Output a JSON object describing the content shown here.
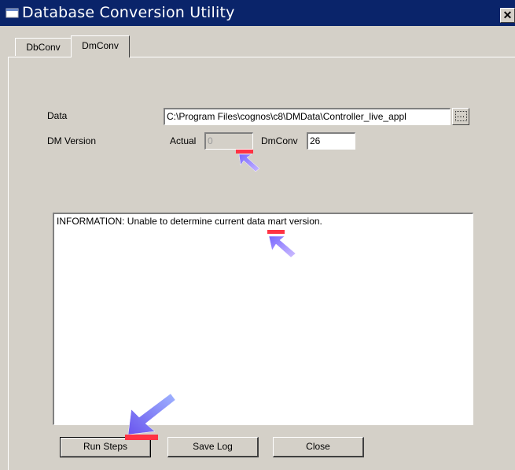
{
  "window": {
    "title": "Database Conversion Utility",
    "close_glyph": "✕"
  },
  "tabs": [
    {
      "label": "DbConv",
      "selected": false
    },
    {
      "label": "DmConv",
      "selected": true
    }
  ],
  "form": {
    "data_label": "Data",
    "data_value": "C:\\Program Files\\cognos\\c8\\DMData\\Controller_live_appl",
    "browse_label": "...",
    "dm_version_label": "DM Version",
    "actual_label": "Actual",
    "actual_value": "0",
    "dmconv_label": "DmConv",
    "dmconv_value": "26"
  },
  "log": {
    "text": "INFORMATION:  Unable to determine current data mart version."
  },
  "buttons": {
    "run_steps": "Run Steps",
    "save_log": "Save Log",
    "close": "Close"
  },
  "colors": {
    "titlebar": "#0a246a",
    "face": "#d4d0c8",
    "annotation_arrow_head": "#ff3344",
    "annotation_arrow_body": "#8877ee"
  },
  "icons": {
    "window_icon": "app-icon",
    "close": "close-icon",
    "browse": "ellipsis-icon",
    "annotation": "arrow-pointer-icon"
  }
}
